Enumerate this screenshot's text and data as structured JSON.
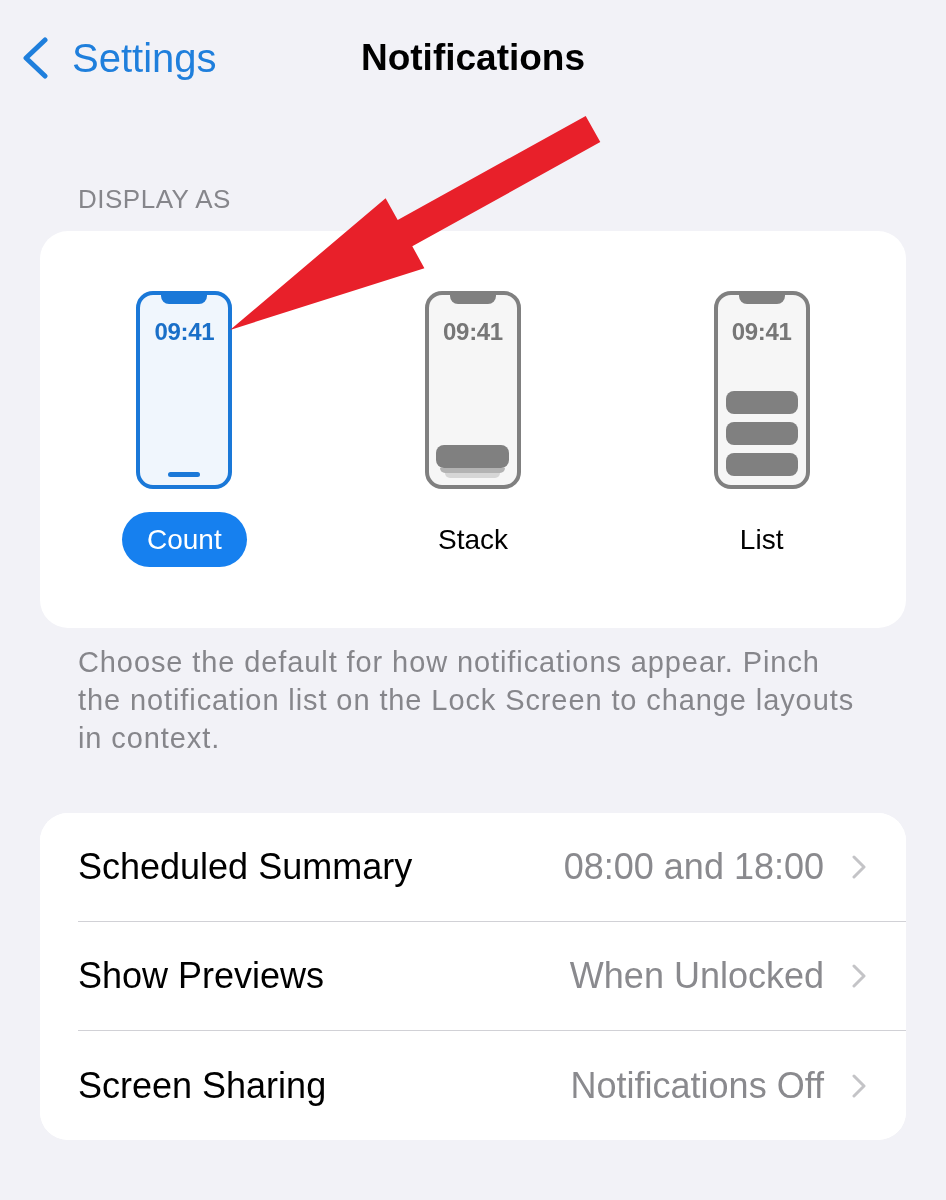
{
  "nav": {
    "back_label": "Settings",
    "title": "Notifications"
  },
  "display_as": {
    "header": "DISPLAY AS",
    "options": [
      {
        "kind": "count",
        "label": "Count",
        "time": "09:41",
        "selected": true
      },
      {
        "kind": "stack",
        "label": "Stack",
        "time": "09:41",
        "selected": false
      },
      {
        "kind": "list",
        "label": "List",
        "time": "09:41",
        "selected": false
      }
    ],
    "footer": "Choose the default for how notifications appear. Pinch the notification list on the Lock Screen to change layouts in context."
  },
  "settings": [
    {
      "label": "Scheduled Summary",
      "value": "08:00 and 18:00"
    },
    {
      "label": "Show Previews",
      "value": "When Unlocked"
    },
    {
      "label": "Screen Sharing",
      "value": "Notifications Off"
    }
  ],
  "annotations": [
    {
      "kind": "arrow"
    }
  ]
}
